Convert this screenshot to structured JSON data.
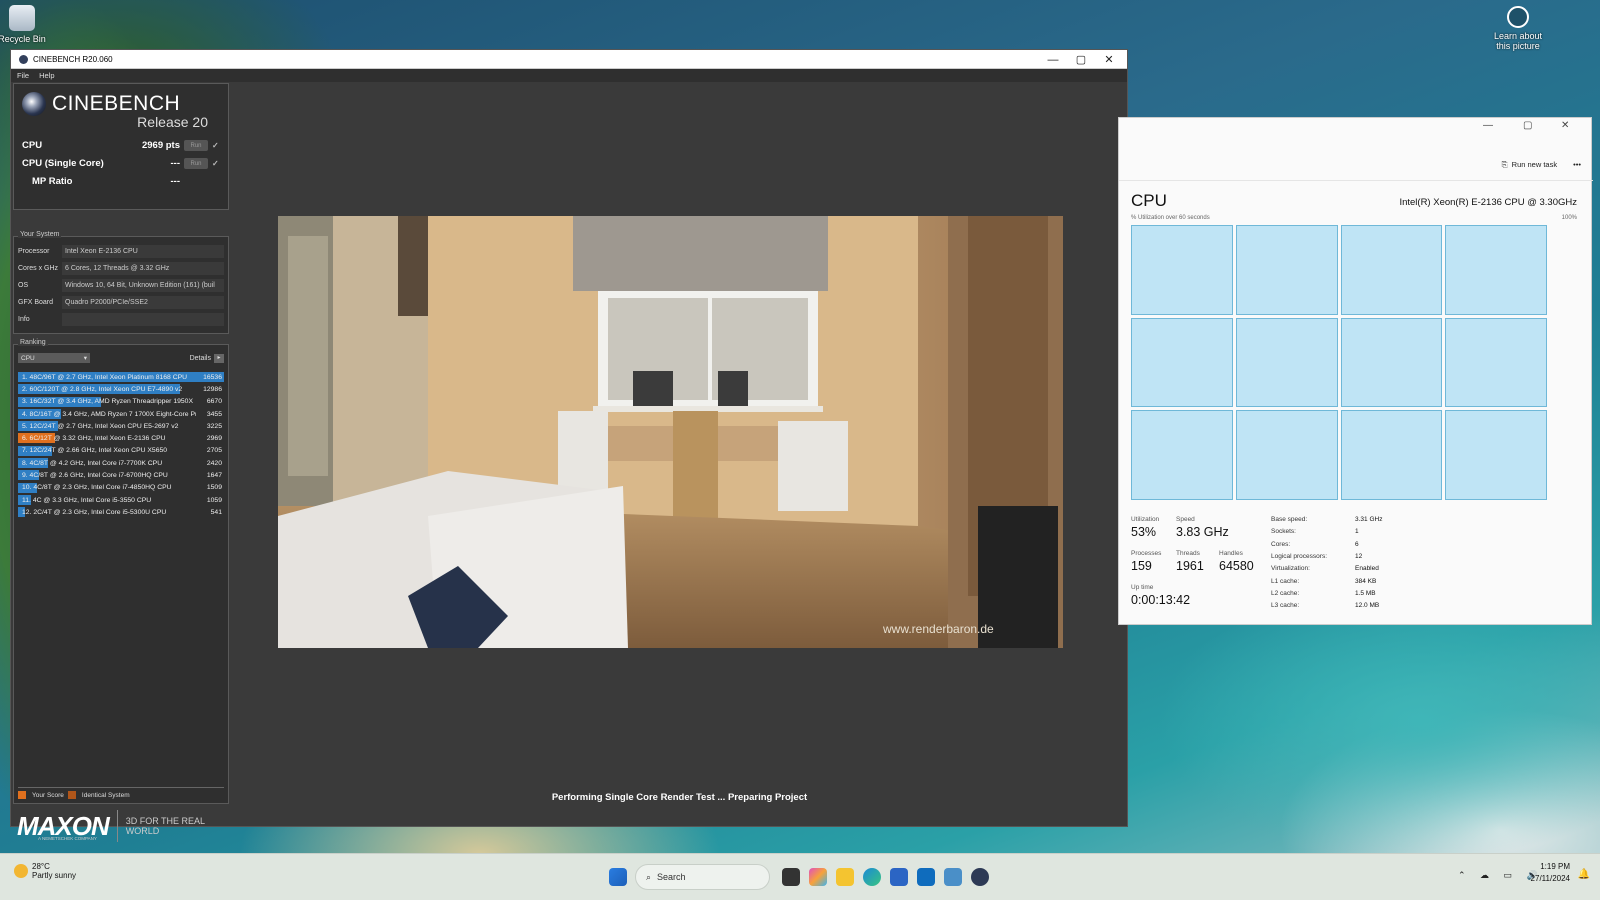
{
  "desktop": {
    "icons": [
      {
        "label": "Recycle Bin"
      },
      {
        "label": "Learn about this picture"
      }
    ]
  },
  "cinebench": {
    "window_title": "CINEBENCH R20.060",
    "menu": [
      "File",
      "Help"
    ],
    "brand": "CINEBENCH",
    "release": "Release 20",
    "scores": [
      {
        "label": "CPU",
        "value": "2969 pts",
        "run": "Run",
        "check": "✓"
      },
      {
        "label": "CPU (Single Core)",
        "value": "---",
        "run": "Run",
        "check": "✓"
      },
      {
        "label": "MP Ratio",
        "value": "---"
      }
    ],
    "system_title": "Your System",
    "system": [
      {
        "key": "Processor",
        "value": "Intel Xeon E-2136 CPU"
      },
      {
        "key": "Cores x GHz",
        "value": "6 Cores, 12 Threads @ 3.32 GHz"
      },
      {
        "key": "OS",
        "value": "Windows 10, 64 Bit, Unknown Edition (161) (buil"
      },
      {
        "key": "GFX Board",
        "value": "Quadro P2000/PCIe/SSE2"
      },
      {
        "key": "Info",
        "value": ""
      }
    ],
    "ranking_title": "Ranking",
    "ranking_select": "CPU",
    "details_label": "Details",
    "ranking": [
      {
        "label": "1. 48C/96T @ 2.7 GHz, Intel Xeon Platinum 8168 CPU",
        "score": "16536",
        "value": 16536,
        "color": "#2f7fc4"
      },
      {
        "label": "2. 60C/120T @ 2.8 GHz, Intel Xeon CPU E7-4890 v2",
        "score": "12986",
        "value": 12986,
        "color": "#2f7fc4"
      },
      {
        "label": "3. 16C/32T @ 3.4 GHz, AMD Ryzen Threadripper 1950X",
        "score": "6670",
        "value": 6670,
        "color": "#2f7fc4"
      },
      {
        "label": "4. 8C/16T @ 3.4 GHz, AMD Ryzen 7 1700X Eight-Core Pr",
        "score": "3455",
        "value": 3455,
        "color": "#2f7fc4"
      },
      {
        "label": "5. 12C/24T @ 2.7 GHz, Intel Xeon CPU E5-2697 v2",
        "score": "3225",
        "value": 3225,
        "color": "#2f7fc4"
      },
      {
        "label": "6. 6C/12T @ 3.32 GHz, Intel Xeon E-2136 CPU",
        "score": "2969",
        "value": 2969,
        "color": "#e0701e"
      },
      {
        "label": "7. 12C/24T @ 2.66 GHz, Intel Xeon CPU X5650",
        "score": "2705",
        "value": 2705,
        "color": "#2f7fc4"
      },
      {
        "label": "8. 4C/8T @ 4.2 GHz, Intel Core i7-7700K CPU",
        "score": "2420",
        "value": 2420,
        "color": "#2f7fc4"
      },
      {
        "label": "9. 4C/8T @ 2.6 GHz, Intel Core i7-6700HQ CPU",
        "score": "1647",
        "value": 1647,
        "color": "#2f7fc4"
      },
      {
        "label": "10. 4C/8T @ 2.3 GHz, Intel Core i7-4850HQ CPU",
        "score": "1509",
        "value": 1509,
        "color": "#2f7fc4"
      },
      {
        "label": "11. 4C @ 3.3 GHz, Intel Core i5-3550 CPU",
        "score": "1059",
        "value": 1059,
        "color": "#2f7fc4"
      },
      {
        "label": "12. 2C/4T @ 2.3 GHz, Intel Core i5-5300U CPU",
        "score": "541",
        "value": 541,
        "color": "#2f7fc4"
      }
    ],
    "legend": {
      "your_score": "Your Score",
      "identical": "Identical System",
      "your_color": "#e0701e",
      "identical_color": "#b0561a"
    },
    "maxon": {
      "logo": "MAXON",
      "sub": "A NEMETSCHEK COMPANY",
      "tagline": "3D FOR THE REAL WORLD"
    },
    "watermark": "www.renderbaron.de",
    "status": "Performing Single Core Render Test ... Preparing Project"
  },
  "taskmanager": {
    "run_new_task": "Run new task",
    "more": "•••",
    "title": "CPU",
    "model": "Intel(R) Xeon(R) E-2136 CPU @ 3.30GHz",
    "graph_caption": "% Utilization over 60 seconds",
    "graph_max": "100%",
    "stats": {
      "utilization_label": "Utilization",
      "utilization": "53%",
      "speed_label": "Speed",
      "speed": "3.83 GHz",
      "processes_label": "Processes",
      "processes": "159",
      "threads_label": "Threads",
      "threads": "1961",
      "handles_label": "Handles",
      "handles": "64580",
      "uptime_label": "Up time",
      "uptime": "0:00:13:42"
    },
    "details": [
      {
        "k": "Base speed:",
        "v": "3.31 GHz"
      },
      {
        "k": "Sockets:",
        "v": "1"
      },
      {
        "k": "Cores:",
        "v": "6"
      },
      {
        "k": "Logical processors:",
        "v": "12"
      },
      {
        "k": "Virtualization:",
        "v": "Enabled"
      },
      {
        "k": "L1 cache:",
        "v": "384 KB"
      },
      {
        "k": "L2 cache:",
        "v": "1.5 MB"
      },
      {
        "k": "L3 cache:",
        "v": "12.0 MB"
      }
    ]
  },
  "taskbar": {
    "temp": "28°C",
    "weather": "Partly sunny",
    "search": "Search",
    "time": "1:19 PM",
    "date": "27/11/2024"
  }
}
